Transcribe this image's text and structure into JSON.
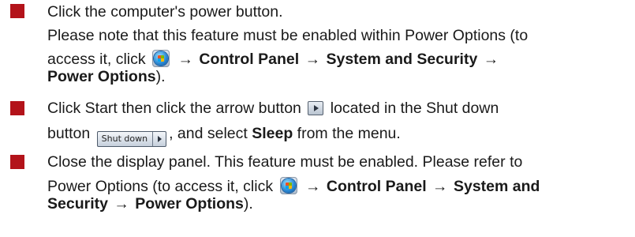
{
  "accent_color": "#b3131a",
  "icons": {
    "start_orb": "windows-start-orb-icon",
    "arrow_button": "shutdown-arrow-icon"
  },
  "item1": {
    "line1": "Click the computer's power button.",
    "line2": "Please note that this feature must be enabled within Power Options  (to",
    "line3_pre": "access it, click",
    "arrow": "→",
    "control_panel": "Control Panel",
    "system_security": "System and Security",
    "power_options": "Power Options",
    "line4_post": ")."
  },
  "item2": {
    "line1_pre": "Click Start then click the arrow button",
    "line1_post": "located in the Shut down",
    "line2_pre": "button",
    "shutdown_label": "Shut down",
    "line2_mid": ", and select",
    "sleep": "Sleep",
    "line2_post": "from the menu."
  },
  "item3": {
    "line1": "Close the display panel. This feature must be enabled. Please refer to",
    "line2_pre": "Power Options  (to access it, click",
    "control_panel": "Control Panel",
    "system_and": "System and",
    "security": "Security",
    "power_options": "Power Options",
    "line3_post": ")."
  }
}
